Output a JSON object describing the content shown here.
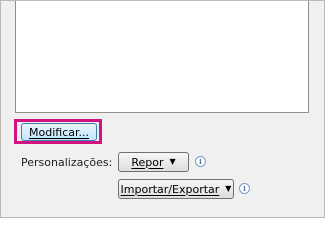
{
  "buttons": {
    "modify_label": "Modificar...",
    "reset_label": "Repor",
    "import_export_label": "Importar/Exportar"
  },
  "customizations": {
    "label": "Personalizações:"
  },
  "icons": {
    "dropdown": "caret-down-icon",
    "info": "info-icon"
  },
  "colors": {
    "highlight": "#d1127f",
    "accent": "#3c7fb1"
  }
}
